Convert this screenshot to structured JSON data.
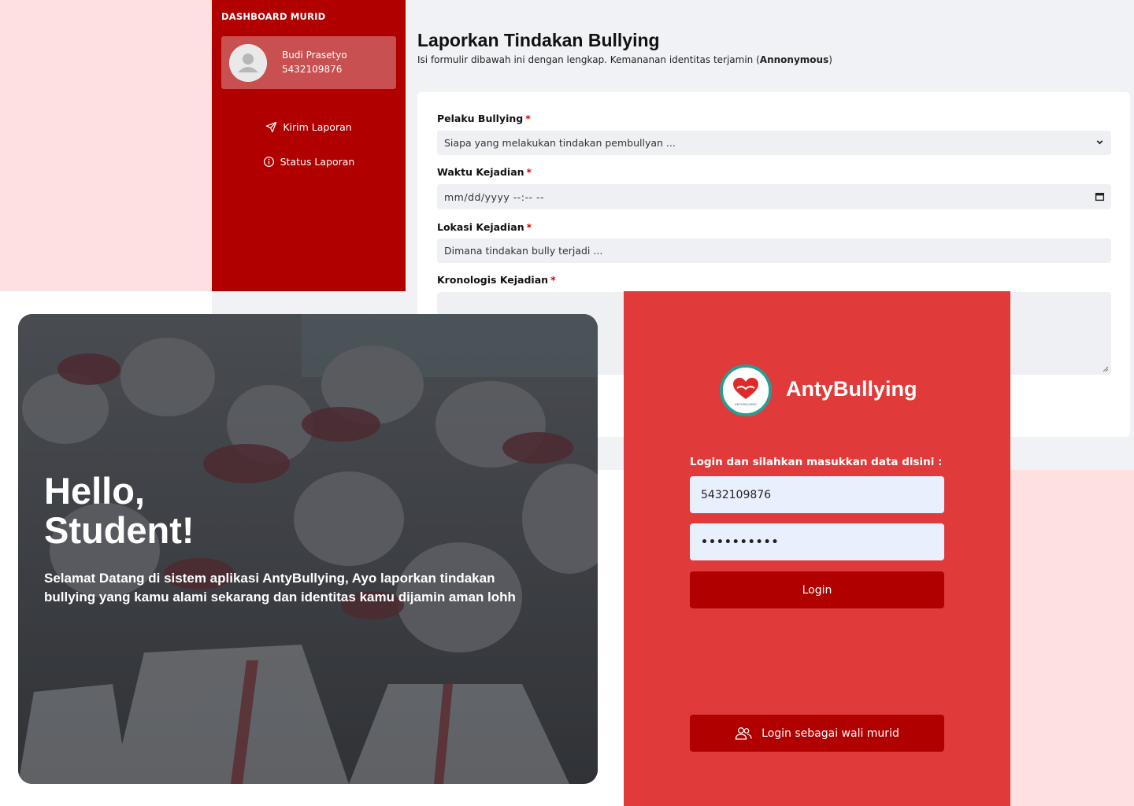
{
  "dashboard": {
    "sidebar_title": "DASHBOARD MURID",
    "profile": {
      "name": "Budi Prasetyo",
      "id": "5432109876"
    },
    "nav": [
      {
        "label": "Kirim Laporan",
        "icon": "send-icon"
      },
      {
        "label": "Status Laporan",
        "icon": "info-icon"
      }
    ],
    "title": "Laporkan Tindakan Bullying",
    "subtitle_prefix": "Isi formulir dibawah ini dengan lengkap. Kemananan identitas terjamin (",
    "subtitle_bold": "Annonymous",
    "subtitle_suffix": ")",
    "form": {
      "pelaku_label": "Pelaku Bullying",
      "pelaku_placeholder": "Siapa yang melakukan tindakan pembullyan ...",
      "waktu_label": "Waktu Kejadian",
      "waktu_placeholder": "mm/dd/yyyy --:-- --",
      "lokasi_label": "Lokasi Kejadian",
      "lokasi_placeholder": "Dimana tindakan bully terjadi ...",
      "kronologis_label": "Kronologis Kejadian",
      "required_mark": "*"
    }
  },
  "hero": {
    "greeting_line1": "Hello,",
    "greeting_line2": "Student!",
    "welcome": "Selamat Datang di sistem aplikasi AntyBullying, Ayo laporkan tindakan bullying yang kamu alami sekarang dan identitas kamu dijamin aman lohh"
  },
  "login": {
    "brand": "AntyBullying",
    "logo_text": "ANTY-BULLYING",
    "hint": "Login dan silahkan masukkan data disini :",
    "username_value": "5432109876",
    "password_value": "••••••••••",
    "login_button": "Login",
    "parent_button": "Login sebagai wali murid"
  },
  "colors": {
    "sidebar": "#b00000",
    "login_panel": "#e03a3a",
    "button": "#b00000",
    "pink_bg": "#ffe0e0",
    "logo_ring": "#2a9d93"
  }
}
